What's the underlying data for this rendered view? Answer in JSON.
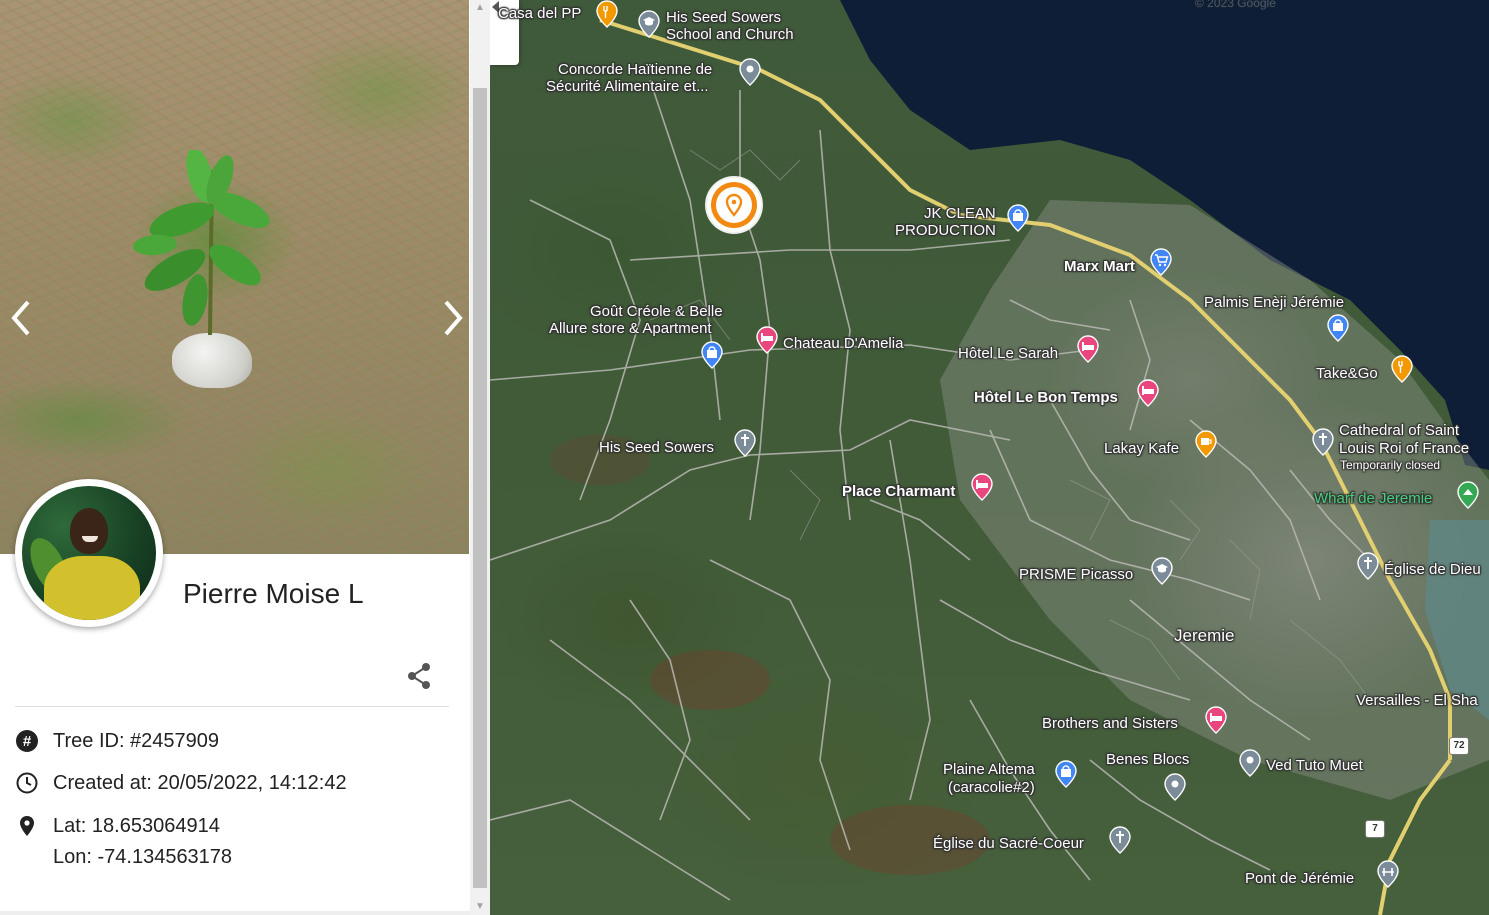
{
  "tree_panel": {
    "planter_name": "Pierre Moise L",
    "tree_id": "Tree ID: #2457909",
    "created_at": "Created at: 20/05/2022, 14:12:42",
    "latitude": "Lat: 18.653064914",
    "longitude": "Lon: -74.134563178",
    "prev_icon": "chevron-left-icon",
    "next_icon": "chevron-right-icon",
    "share_icon": "share-icon",
    "id_icon": "hash-icon",
    "created_icon": "clock-icon",
    "location_icon": "location-pin-icon"
  },
  "map": {
    "collapse_icon": "chevron-left-icon",
    "watermark": "© 2023 Google",
    "selected_marker_color": "#f28a12",
    "places": [
      {
        "name": "Casa del PP",
        "icon": "restaurant-icon",
        "color": "#f29900"
      },
      {
        "name_line1": "His Seed Sowers",
        "name_line2": "School and Church",
        "icon": "school-icon",
        "color": "#7b8b98"
      },
      {
        "name_line1": "Concorde Haïtienne de",
        "name_line2": "Sécurité Alimentaire et...",
        "icon": "place-icon",
        "color": "#7b8b98"
      },
      {
        "name_line1": "JK CLEAN",
        "name_line2": "PRODUCTION",
        "icon": "shopping-icon",
        "color": "#4285f4"
      },
      {
        "name": "Marx Mart",
        "icon": "cart-icon",
        "color": "#4285f4"
      },
      {
        "name": "Palmis Enèji Jérémie",
        "icon": "shopping-icon",
        "color": "#4285f4"
      },
      {
        "name_line1": "Goût Créole & Belle",
        "name_line2": "Allure store & Apartment",
        "icon": "shopping-icon",
        "color": "#4285f4"
      },
      {
        "name": "Chateau D'Amelia",
        "icon": "hotel-icon",
        "color": "#e8467c"
      },
      {
        "name": "Hôtel Le Sarah",
        "icon": "hotel-icon",
        "color": "#e8467c"
      },
      {
        "name": "Take&Go",
        "icon": "restaurant-icon",
        "color": "#f29900"
      },
      {
        "name": "Hôtel Le Bon Temps",
        "icon": "hotel-icon",
        "color": "#e8467c"
      },
      {
        "name_line1": "Cathedral of Saint",
        "name_line2": "Louis Roi of France",
        "note": "Temporarily closed",
        "icon": "church-icon",
        "color": "#7b8b98"
      },
      {
        "name": "His Seed Sowers",
        "icon": "church-icon",
        "color": "#7b8b98"
      },
      {
        "name": "Lakay Kafe",
        "icon": "cafe-icon",
        "color": "#f29900"
      },
      {
        "name": "Wharf de Jeremie",
        "icon": "park-icon",
        "color": "#34a853"
      },
      {
        "name": "Place Charmant",
        "icon": "hotel-icon",
        "color": "#e8467c"
      },
      {
        "name": "Église de Dieu",
        "icon": "church-icon",
        "color": "#7b8b98"
      },
      {
        "name": "PRISME Picasso",
        "icon": "school-icon",
        "color": "#7b8b98"
      },
      {
        "name": "Jeremie",
        "icon": "",
        "color": "#ffffff"
      },
      {
        "name": "Versailles - El Sha",
        "icon": "",
        "color": "#ffffff"
      },
      {
        "name": "Brothers and Sisters",
        "icon": "hotel-icon",
        "color": "#e8467c"
      },
      {
        "name": "Benes Blocs",
        "icon": "place-icon",
        "color": "#7b8b98"
      },
      {
        "name": "Ved Tuto Muet",
        "icon": "place-icon",
        "color": "#7b8b98"
      },
      {
        "name_line1": "Plaine Altema",
        "name_line2": "(caracolie#2)",
        "icon": "shopping-icon",
        "color": "#4285f4"
      },
      {
        "name": "Église du Sacré-Coeur",
        "icon": "church-icon",
        "color": "#7b8b98"
      },
      {
        "name": "Pont de Jérémie",
        "icon": "bridge-icon",
        "color": "#7b8b98"
      }
    ],
    "route_shields": [
      "72",
      "7"
    ]
  }
}
